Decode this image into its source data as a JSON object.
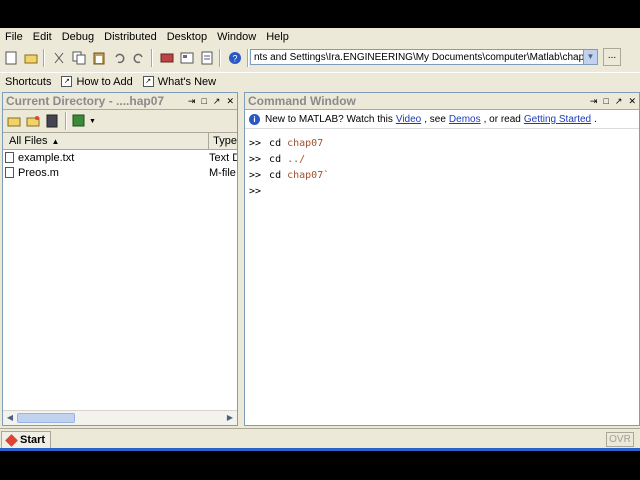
{
  "menu": [
    "File",
    "Edit",
    "Debug",
    "Distributed",
    "Desktop",
    "Window",
    "Help"
  ],
  "toolbar": {
    "path": "nts and Settings\\Ira.ENGINEERING\\My Documents\\computer\\Matlab\\chap07",
    "browse_label": "..."
  },
  "shortcuts": {
    "label": "Shortcuts",
    "how_to_add": "How to Add",
    "whats_new": "What's New"
  },
  "current_directory": {
    "title": "Current Directory - ....hap07",
    "columns": {
      "name": "All Files",
      "type": "Type"
    },
    "files": [
      {
        "name": "example.txt",
        "type": "Text D"
      },
      {
        "name": "Preos.m",
        "type": "M-file"
      }
    ]
  },
  "command_window": {
    "title": "Command Window",
    "info": {
      "prefix": "New to MATLAB? Watch this",
      "video": "Video",
      "mid1": ", see",
      "demos": "Demos",
      "mid2": ", or read",
      "getting_started": "Getting Started",
      "suffix": "."
    },
    "lines": [
      {
        "prompt": ">>",
        "cmd": "cd",
        "arg": "chap07"
      },
      {
        "prompt": ">>",
        "cmd": "cd",
        "arg": "../"
      },
      {
        "prompt": ">>",
        "cmd": "cd",
        "arg": "chap07`"
      },
      {
        "prompt": ">>",
        "cmd": "",
        "arg": ""
      }
    ]
  },
  "status": {
    "start_label": "Start",
    "ovr": "OVR"
  },
  "colors": {
    "chrome": "#ece9d8",
    "link": "#1d3bb8",
    "string": "#a0522d",
    "accent_bar": "#2b63c9"
  }
}
